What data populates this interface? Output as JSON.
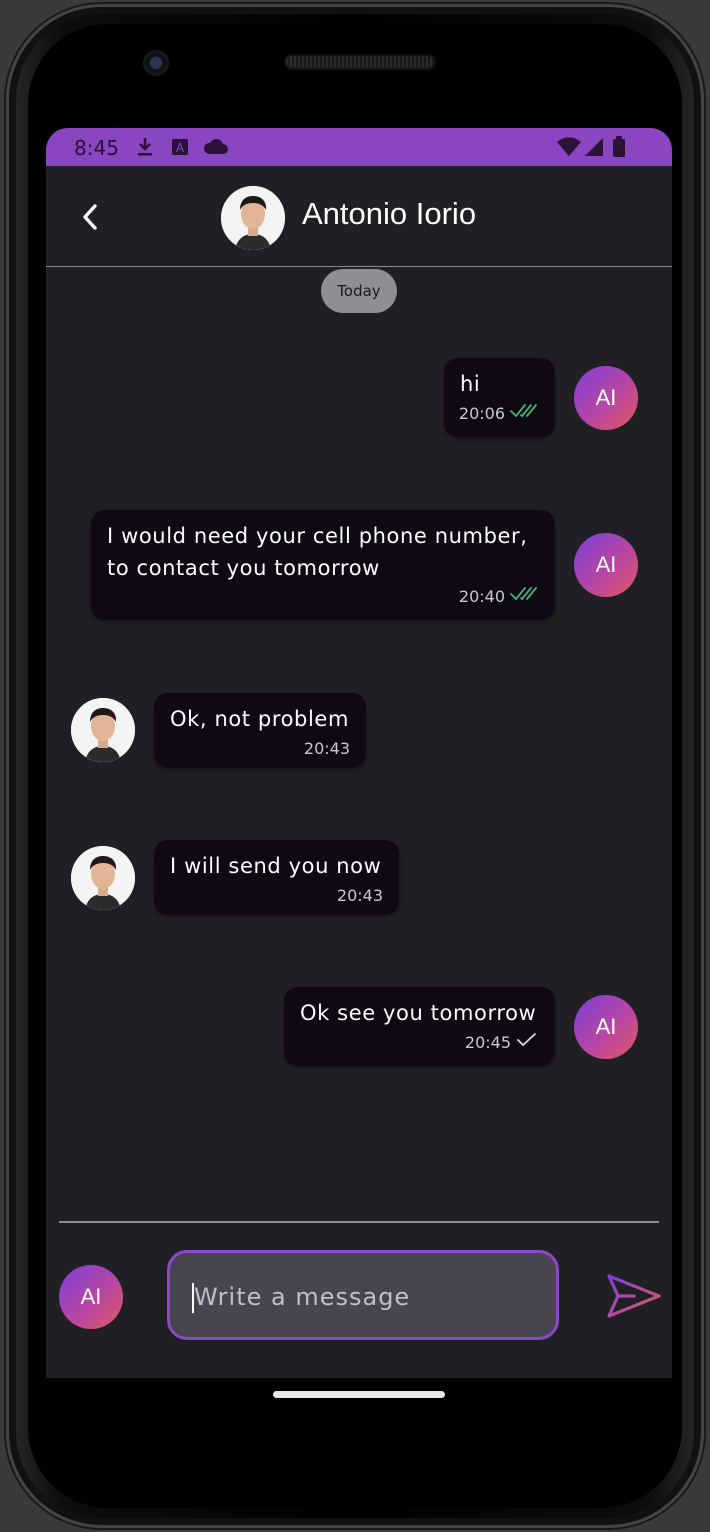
{
  "status_bar": {
    "time": "8:45",
    "icons": [
      "download-icon",
      "a-icon",
      "cloud-icon",
      "wifi-icon",
      "signal-icon",
      "battery-icon"
    ]
  },
  "header": {
    "contact_name": "Antonio Iorio",
    "back_icon": "chevron-left-icon"
  },
  "date_chip": "Today",
  "messages": [
    {
      "from": "me",
      "text": "hi",
      "time": "20:06",
      "status": "read"
    },
    {
      "from": "me",
      "text": "I would need your cell phone number,\nto contact you tomorrow",
      "time": "20:40",
      "status": "read"
    },
    {
      "from": "contact",
      "text": "Ok, not problem",
      "time": "20:43"
    },
    {
      "from": "contact",
      "text": "I will send you now",
      "time": "20:43"
    },
    {
      "from": "me",
      "text": "Ok see you tomorrow",
      "time": "20:45",
      "status": "sent"
    }
  ],
  "user_avatar_initials": "AI",
  "composer": {
    "placeholder": "Write a message",
    "send_icon": "send-icon"
  },
  "colors": {
    "accent": "#8a45c1",
    "background": "#201f23",
    "bubble": "#0e0912",
    "read_check": "#4caf7a"
  }
}
